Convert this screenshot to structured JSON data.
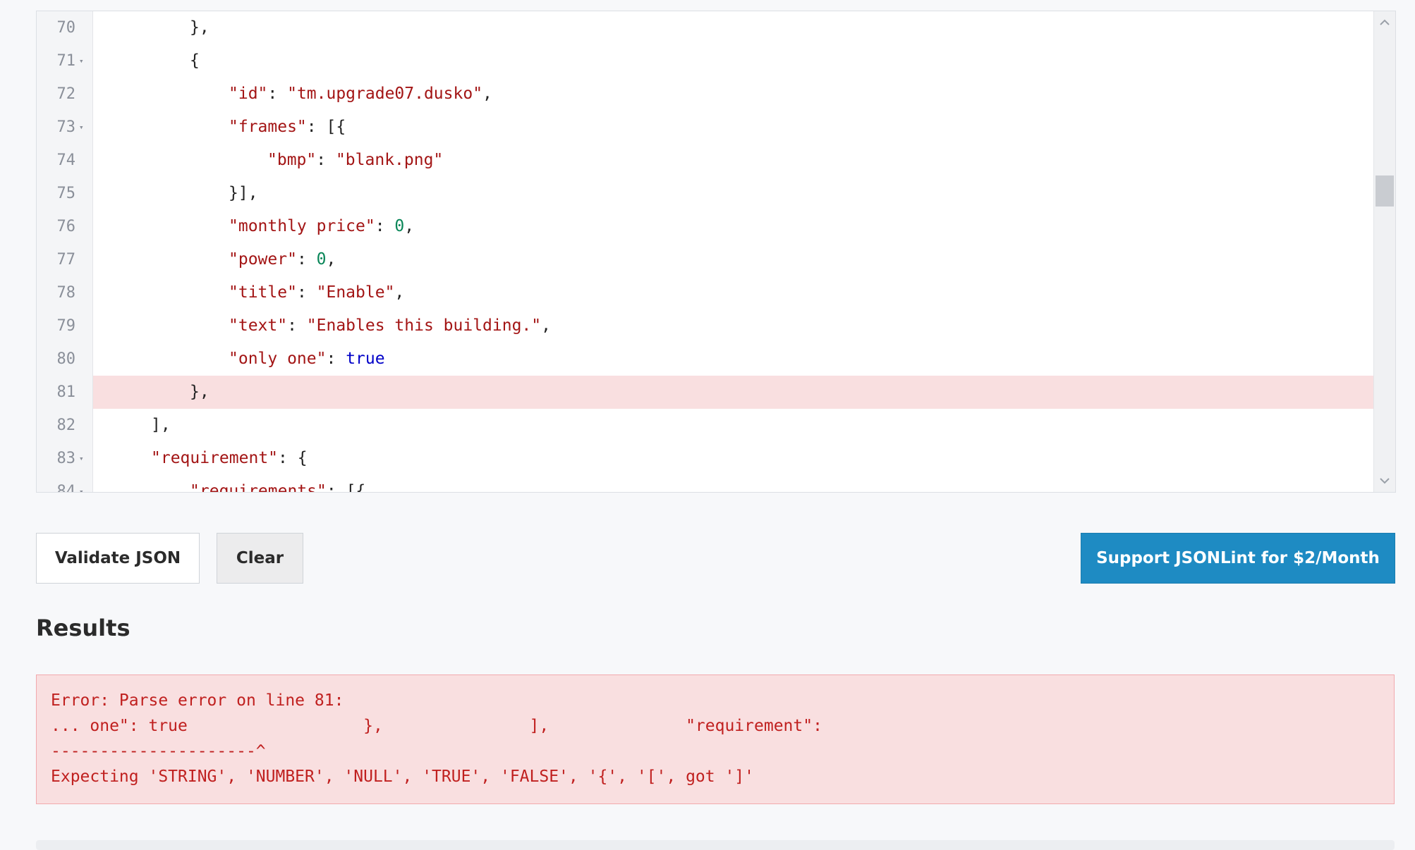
{
  "editor": {
    "lines": [
      {
        "num": "70",
        "fold": false,
        "error": false,
        "indent": 3,
        "tokens": [
          {
            "t": "pun",
            "v": "},"
          }
        ]
      },
      {
        "num": "71",
        "fold": true,
        "error": false,
        "indent": 3,
        "tokens": [
          {
            "t": "pun",
            "v": "{"
          }
        ]
      },
      {
        "num": "72",
        "fold": false,
        "error": false,
        "indent": 4,
        "tokens": [
          {
            "t": "key",
            "v": "\"id\""
          },
          {
            "t": "pun",
            "v": ": "
          },
          {
            "t": "str",
            "v": "\"tm.upgrade07.dusko\""
          },
          {
            "t": "pun",
            "v": ","
          }
        ]
      },
      {
        "num": "73",
        "fold": true,
        "error": false,
        "indent": 4,
        "tokens": [
          {
            "t": "key",
            "v": "\"frames\""
          },
          {
            "t": "pun",
            "v": ": [{"
          }
        ]
      },
      {
        "num": "74",
        "fold": false,
        "error": false,
        "indent": 5,
        "tokens": [
          {
            "t": "key",
            "v": "\"bmp\""
          },
          {
            "t": "pun",
            "v": ": "
          },
          {
            "t": "str",
            "v": "\"blank.png\""
          }
        ]
      },
      {
        "num": "75",
        "fold": false,
        "error": false,
        "indent": 4,
        "tokens": [
          {
            "t": "pun",
            "v": "}],"
          }
        ]
      },
      {
        "num": "76",
        "fold": false,
        "error": false,
        "indent": 4,
        "tokens": [
          {
            "t": "key",
            "v": "\"monthly price\""
          },
          {
            "t": "pun",
            "v": ": "
          },
          {
            "t": "num",
            "v": "0"
          },
          {
            "t": "pun",
            "v": ","
          }
        ]
      },
      {
        "num": "77",
        "fold": false,
        "error": false,
        "indent": 4,
        "tokens": [
          {
            "t": "key",
            "v": "\"power\""
          },
          {
            "t": "pun",
            "v": ": "
          },
          {
            "t": "num",
            "v": "0"
          },
          {
            "t": "pun",
            "v": ","
          }
        ]
      },
      {
        "num": "78",
        "fold": false,
        "error": false,
        "indent": 4,
        "tokens": [
          {
            "t": "key",
            "v": "\"title\""
          },
          {
            "t": "pun",
            "v": ": "
          },
          {
            "t": "str",
            "v": "\"Enable\""
          },
          {
            "t": "pun",
            "v": ","
          }
        ]
      },
      {
        "num": "79",
        "fold": false,
        "error": false,
        "indent": 4,
        "tokens": [
          {
            "t": "key",
            "v": "\"text\""
          },
          {
            "t": "pun",
            "v": ": "
          },
          {
            "t": "str",
            "v": "\"Enables this building.\""
          },
          {
            "t": "pun",
            "v": ","
          }
        ]
      },
      {
        "num": "80",
        "fold": false,
        "error": false,
        "indent": 4,
        "tokens": [
          {
            "t": "key",
            "v": "\"only one\""
          },
          {
            "t": "pun",
            "v": ": "
          },
          {
            "t": "bool",
            "v": "true"
          }
        ]
      },
      {
        "num": "81",
        "fold": false,
        "error": true,
        "indent": 3,
        "tokens": [
          {
            "t": "pun",
            "v": "},"
          }
        ]
      },
      {
        "num": "82",
        "fold": false,
        "error": false,
        "indent": 2,
        "tokens": [
          {
            "t": "pun",
            "v": "],"
          }
        ]
      },
      {
        "num": "83",
        "fold": true,
        "error": false,
        "indent": 2,
        "tokens": [
          {
            "t": "key",
            "v": "\"requirement\""
          },
          {
            "t": "pun",
            "v": ": {"
          }
        ]
      },
      {
        "num": "84",
        "fold": true,
        "error": false,
        "indent": 3,
        "tokens": [
          {
            "t": "key",
            "v": "\"requirements\""
          },
          {
            "t": "pun",
            "v": ": [{"
          }
        ]
      }
    ]
  },
  "icons": {
    "scroll_up": "chevron-up-icon",
    "scroll_down": "chevron-down-icon",
    "fold": "triangle-down-icon"
  },
  "buttons": {
    "validate": "Validate JSON",
    "clear": "Clear",
    "support": "Support JSONLint for $2/Month"
  },
  "results": {
    "title": "Results",
    "error_lines": [
      "Error: Parse error on line 81:",
      "... one\": true                  },               ],              \"requirement\":",
      "---------------------^",
      "Expecting 'STRING', 'NUMBER', 'NULL', 'TRUE', 'FALSE', '{', '[', got ']'"
    ]
  },
  "colors": {
    "accent": "#1e8bc3",
    "error_bg": "#f9dfe0",
    "error_text": "#c0201f",
    "json_key": "#a31515",
    "json_number": "#098658",
    "json_bool": "#0000c8"
  }
}
